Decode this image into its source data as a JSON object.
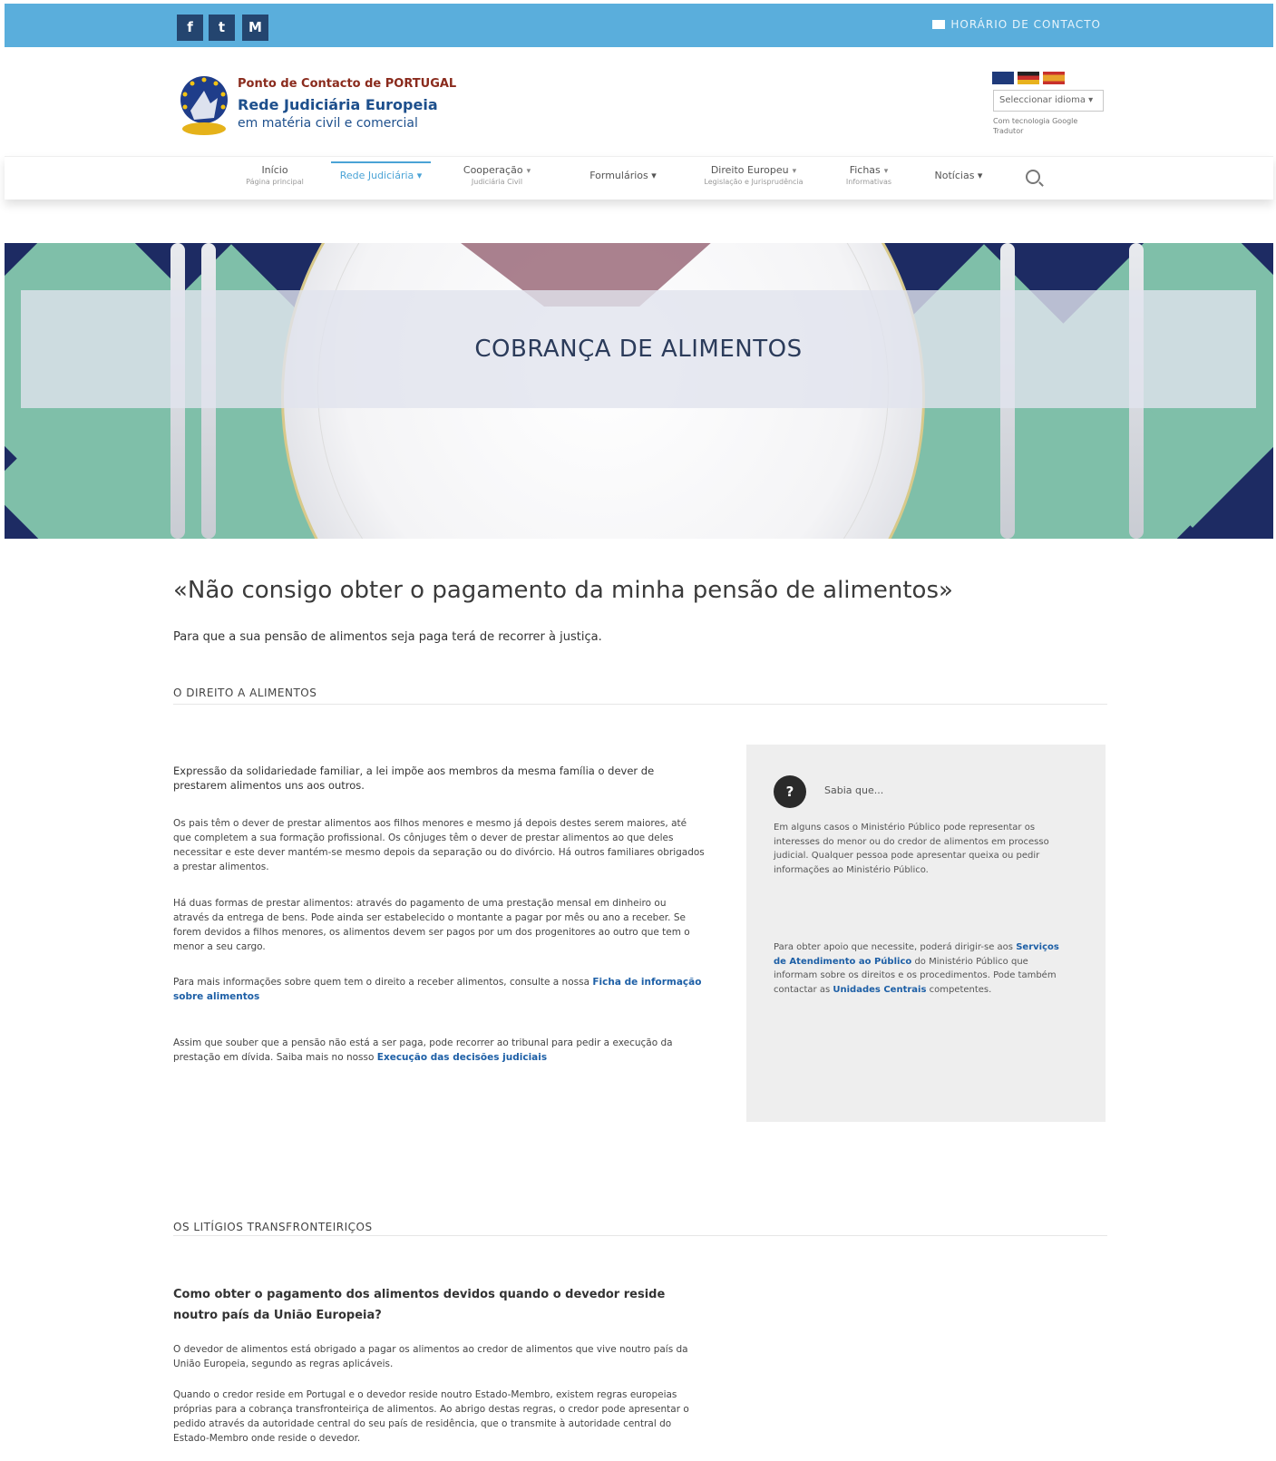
{
  "topbar": {
    "social": [
      {
        "name": "facebook",
        "glyph": "f"
      },
      {
        "name": "twitter",
        "glyph": "t"
      },
      {
        "name": "email",
        "glyph": "M"
      }
    ],
    "contact_label": "HORÁRIO DE CONTACTO"
  },
  "header": {
    "brand_line1": "Ponto de Contacto de PORTUGAL",
    "brand_line2": "Rede Judiciária Europeia",
    "brand_line3": "em matéria civil e comercial",
    "language_select": "Seleccionar idioma ▾",
    "translate_note": "Com tecnologia Google Tradutor",
    "flags": [
      {
        "name": "en-flag",
        "color": "#1f3a7a"
      },
      {
        "name": "de-flag",
        "color": "#c8302c"
      },
      {
        "name": "es-flag",
        "color": "#e8a22b"
      }
    ]
  },
  "nav": {
    "items": [
      {
        "label": "Início",
        "sub": "Página principal"
      },
      {
        "label": "Rede Judiciária ▾",
        "sub": "",
        "active": true
      },
      {
        "label": "Cooperação",
        "sub": "Judiciária Civil"
      },
      {
        "label": "Formulários ▾",
        "sub": ""
      },
      {
        "label": "Direito Europeu",
        "sub": "Legislação e Jurisprudência"
      },
      {
        "label": "Fichas",
        "sub": "Informativas"
      },
      {
        "label": "Notícias ▾",
        "sub": ""
      }
    ]
  },
  "hero": {
    "title": "COBRANÇA DE ALIMENTOS"
  },
  "main": {
    "title": "«Não consigo obter o pagamento da minha pensão de alimentos»",
    "lead": "Para que a sua pensão de alimentos seja paga terá de recorrer à justiça.",
    "section1_title": "O DIREITO A ALIMENTOS",
    "p1": "Expressão da solidariedade familiar, a lei impõe aos membros da mesma família o dever de prestarem alimentos uns aos outros.",
    "p2": "Os pais têm o dever de prestar alimentos aos filhos menores e mesmo já depois destes serem maiores, até que completem a sua formação profissional. Os cônjuges têm o dever de prestar alimentos ao que deles necessitar e este dever mantém-se mesmo depois da separação ou do divórcio. Há outros familiares obrigados a prestar alimentos.",
    "p3": "Há duas formas de prestar alimentos: através do pagamento de uma prestação mensal em dinheiro ou através da entrega de bens. Pode ainda ser estabelecido o montante a pagar por mês ou ano a receber. Se forem devidos a filhos menores, os alimentos devem ser pagos por um dos progenitores ao outro que tem o menor a seu cargo.",
    "p4_text": "Para mais informações sobre quem tem o direito a receber alimentos, consulte a nossa",
    "p4_link": "Ficha de informação sobre alimentos",
    "p5_text": "Assim que souber que a pensão não está a ser paga, pode recorrer ao tribunal para pedir a execução da prestação em dívida. Saiba mais no nosso",
    "p5_link": "Execução das decisões judiciais",
    "sidebar": {
      "title": "Sabia que...",
      "text1": "Em alguns casos o Ministério Público pode representar os interesses do menor ou do credor de alimentos em processo judicial. Qualquer pessoa pode apresentar queixa ou pedir informações ao Ministério Público.",
      "text2_pre": "Para obter apoio que necessite, poderá dirigir-se aos",
      "text2_link1": "Serviços de Atendimento ao Público",
      "text2_mid": "do Ministério Público que informam sobre os direitos e os procedimentos. Pode também contactar as",
      "text2_link2": "Unidades Centrais",
      "text2_post": "competentes."
    },
    "section2_title": "OS LITÍGIOS TRANSFRONTEIRIÇOS",
    "q_title": "Como obter o pagamento dos alimentos devidos quando o devedor reside noutro país da União Europeia?",
    "p6": "O devedor de alimentos está obrigado a pagar os alimentos ao credor de alimentos que vive noutro país da União Europeia, segundo as regras aplicáveis.",
    "p7": "Quando o credor reside em Portugal e o devedor reside noutro Estado-Membro, existem regras europeias próprias para a cobrança transfronteiriça de alimentos. Ao abrigo destas regras, o credor pode apresentar o pedido através da autoridade central do seu país de residência, que o transmite à autoridade central do Estado-Membro onde reside o devedor."
  }
}
